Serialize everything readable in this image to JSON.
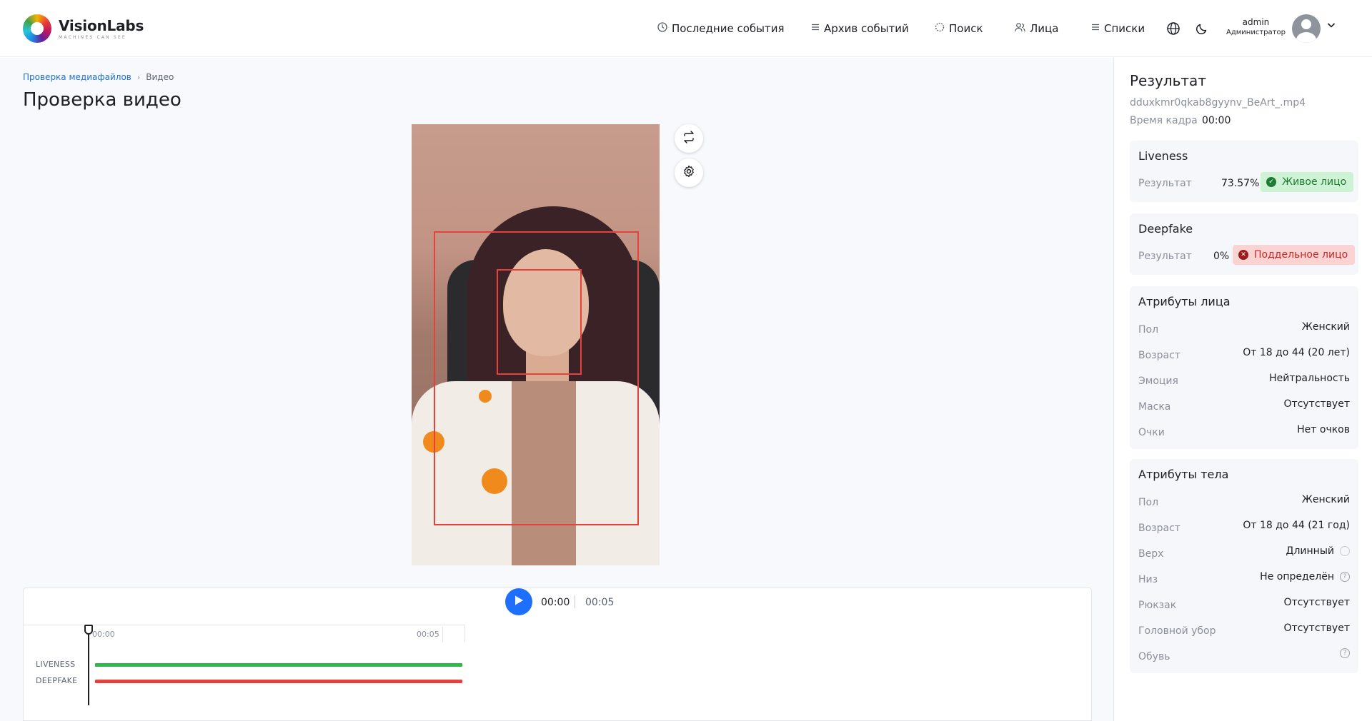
{
  "header": {
    "logo_name": "VisionLabs",
    "logo_tagline": "MACHINES CAN SEE",
    "nav": [
      {
        "label": "Последние события",
        "icon": "clock-icon"
      },
      {
        "label": "Архив событий",
        "icon": "list-icon"
      },
      {
        "label": "Поиск",
        "icon": "search-icon"
      },
      {
        "label": "Лица",
        "icon": "users-icon"
      },
      {
        "label": "Списки",
        "icon": "list-icon"
      }
    ],
    "user": {
      "name": "admin",
      "role": "Администратор"
    }
  },
  "breadcrumb": {
    "parent": "Проверка медиафайлов",
    "current": "Видео"
  },
  "page_title": "Проверка видео",
  "player": {
    "current_time": "00:00",
    "duration": "00:05",
    "ruler_start": "00:00",
    "ruler_end": "00:05",
    "tracks": [
      {
        "label": "LIVENESS",
        "color": "#2eb84b"
      },
      {
        "label": "DEEPFAKE",
        "color": "#e8413c"
      }
    ]
  },
  "result": {
    "title": "Результат",
    "file_name": "dduxkmr0qkab8gyynv_BeArt_.mp4",
    "frame_time_label": "Время кадра",
    "frame_time": "00:00",
    "liveness": {
      "title": "Liveness",
      "label": "Результат",
      "percent": "73.57%",
      "badge": "Живое лицо"
    },
    "deepfake": {
      "title": "Deepfake",
      "label": "Результат",
      "percent": "0%",
      "badge": "Поддельное лицо"
    },
    "face_attrs": {
      "title": "Атрибуты лица",
      "rows": [
        {
          "label": "Пол",
          "value": "Женский"
        },
        {
          "label": "Возраст",
          "value": "От 18 до 44 (20 лет)"
        },
        {
          "label": "Эмоция",
          "value": "Нейтральность"
        },
        {
          "label": "Маска",
          "value": "Отсутствует"
        },
        {
          "label": "Очки",
          "value": "Нет очков"
        }
      ]
    },
    "body_attrs": {
      "title": "Атрибуты тела",
      "rows": [
        {
          "label": "Пол",
          "value": "Женский"
        },
        {
          "label": "Возраст",
          "value": "От 18 до 44 (21 год)"
        },
        {
          "label": "Верх",
          "value": "Длинный"
        },
        {
          "label": "Низ",
          "value": "Не определён"
        },
        {
          "label": "Рюкзак",
          "value": "Отсутствует"
        },
        {
          "label": "Головной убор",
          "value": "Отсутствует"
        },
        {
          "label": "Обувь",
          "value": ""
        }
      ]
    }
  },
  "colors": {
    "accent": "#1f6fff",
    "live": "#2eb84b",
    "fake": "#e8413c"
  }
}
